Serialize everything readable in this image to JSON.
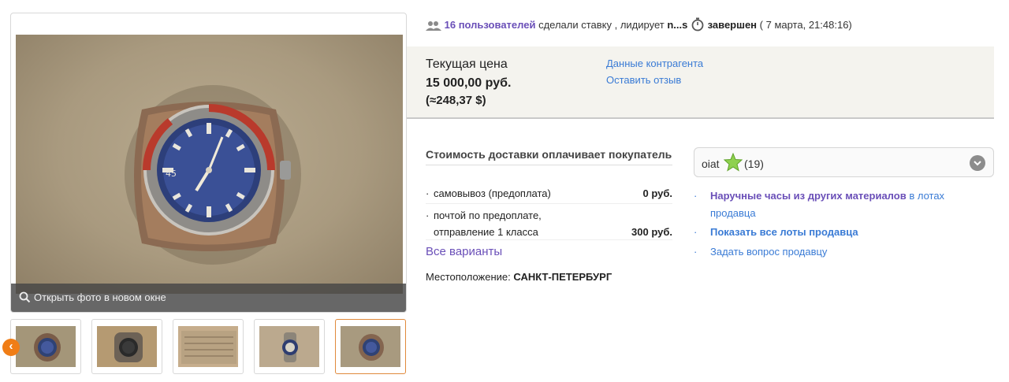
{
  "gallery": {
    "open_photo_label": "Открыть фото в новом окне",
    "thumbnails": [
      "thumb-1",
      "thumb-2",
      "thumb-3",
      "thumb-4",
      "thumb-5"
    ],
    "selected_thumbnail": 5,
    "prev_label": "‹"
  },
  "bids": {
    "users_link": "16 пользователей",
    "made_bid": " сделали ставку , лидирует ",
    "leader": "n...s",
    "status": "завершен",
    "ended_at": " ( 7 марта, 21:48:16)"
  },
  "price": {
    "label": "Текущая цена",
    "value": "15 000,00 руб.",
    "usd": "(≈248,37 $)",
    "counterparty_link": "Данные контрагента",
    "feedback_link": "Оставить отзыв"
  },
  "shipping": {
    "title": "Стоимость доставки оплачивает покупатель",
    "options": [
      {
        "bullet": "·",
        "line1": "самовывоз (предоплата)",
        "line2": "",
        "price": "0 руб."
      },
      {
        "bullet": "·",
        "line1": "почтой по предоплате,",
        "line2": "отправление 1 класса",
        "price": "300 руб."
      }
    ],
    "all_variants": "Все варианты",
    "location_label": "Местоположение: ",
    "location_value": "САНКТ-ПЕТЕРБУРГ"
  },
  "seller": {
    "name": "oiat",
    "rating": "(19)",
    "links": {
      "category_link": "Наручные часы из других материалов",
      "category_suffix": " в лотах продавца",
      "all_lots": "Показать все лоты продавца",
      "ask_question": "Задать вопрос продавцу"
    },
    "bullet": "·"
  },
  "colors": {
    "accent_purple": "#6a4fb8",
    "link_blue": "#3a7bd5",
    "selected_orange": "#e08a3c",
    "price_box_bg": "#f4f3ee",
    "star_green": "#8fd14f"
  }
}
